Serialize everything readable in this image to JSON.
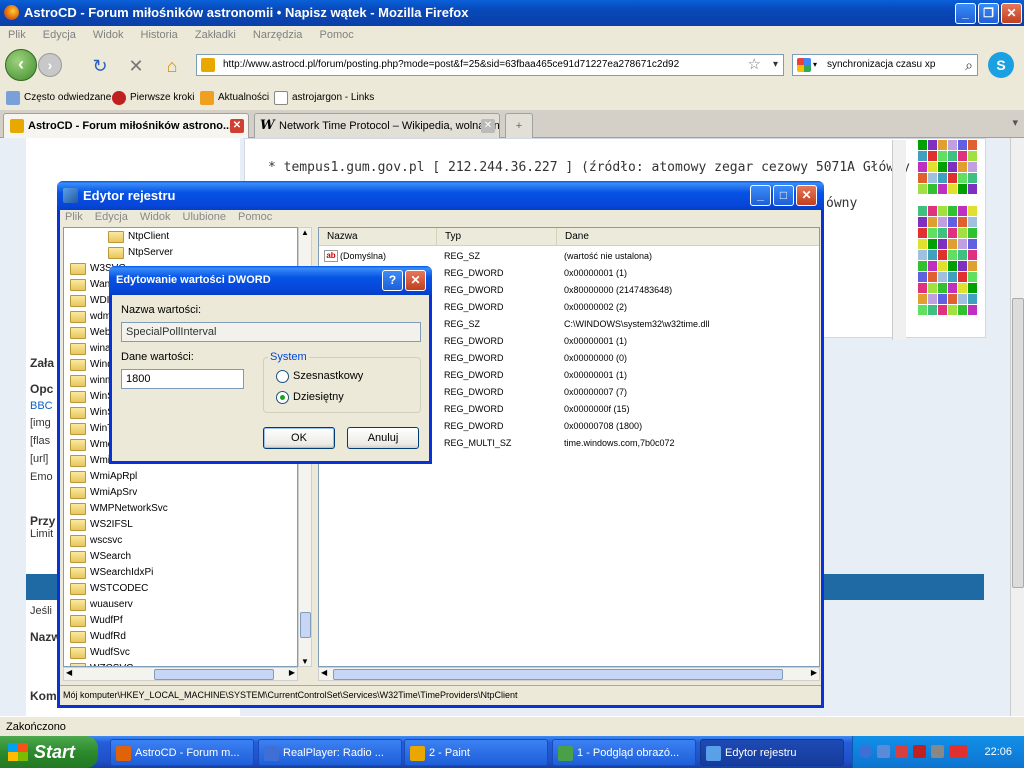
{
  "firefox": {
    "title": "AstroCD - Forum miłośników astronomii • Napisz wątek - Mozilla Firefox",
    "menu": [
      "Plik",
      "Edycja",
      "Widok",
      "Historia",
      "Zakładki",
      "Narzędzia",
      "Pomoc"
    ],
    "url": "http://www.astrocd.pl/forum/posting.php?mode=post&f=25&sid=63fbaa465ce91d71227ea278671c2d92",
    "search_value": "synchronizacja czasu xp",
    "bookmarks": [
      "Często odwiedzane",
      "Pierwsze kroki",
      "Aktualności",
      "astrojargon - Links"
    ],
    "tabs": [
      {
        "label": "AstroCD - Forum miłośników astrono...",
        "active": true
      },
      {
        "label": "Network Time Protocol – Wikipedia, wolna en...",
        "active": false
      }
    ],
    "new_tab_symbol": "+",
    "status": "Zakończono"
  },
  "page": {
    "line1": "* tempus1.gum.gov.pl [ 212.244.36.227 ] (źródło: atomowy zegar cezowy 5071A Główny",
    "line2_tail": "ówny",
    "side_labels": [
      "Zała",
      "Opc",
      "BBC",
      "[img",
      "[flas",
      "[url]",
      "Emo",
      "Przy",
      "Limit",
      "Jeśli",
      "Nazw",
      "Kom"
    ]
  },
  "regedit": {
    "title": "Edytor rejestru",
    "menu": [
      "Plik",
      "Edycja",
      "Widok",
      "Ulubione",
      "Pomoc"
    ],
    "tree": [
      "NtpClient",
      "NtpServer",
      "W3SVC",
      "WanArp",
      "WDICA",
      "wdmaud",
      "WebClient",
      "winachsf",
      "Windows",
      "winmgmt",
      "WinSock",
      "WinSock2",
      "WinTrust",
      "Wmdmpmsn",
      "Wmi",
      "WmiApRpl",
      "WmiApSrv",
      "WMPNetworkSvc",
      "WS2IFSL",
      "wscsvc",
      "WSearch",
      "WSearchIdxPi",
      "WSTCODEC",
      "wuauserv",
      "WudfPf",
      "WudfRd",
      "WudfSvc",
      "WZCSVC"
    ],
    "columns": [
      "Nazwa",
      "Typ",
      "Dane"
    ],
    "rows": [
      {
        "name": "(Domyślna)",
        "type": "REG_SZ",
        "data": "(wartość nie ustalona)"
      },
      {
        "name": "",
        "type": "REG_DWORD",
        "data": "0x00000001 (1)"
      },
      {
        "name": "",
        "type": "REG_DWORD",
        "data": "0x80000000 (2147483648)"
      },
      {
        "name": "",
        "type": "REG_DWORD",
        "data": "0x00000002 (2)"
      },
      {
        "name": "",
        "type": "REG_SZ",
        "data": "C:\\WINDOWS\\system32\\w32time.dll"
      },
      {
        "name": "",
        "type": "REG_DWORD",
        "data": "0x00000001 (1)"
      },
      {
        "name": "",
        "type": "REG_DWORD",
        "data": "0x00000000 (0)"
      },
      {
        "name": "",
        "type": "REG_DWORD",
        "data": "0x00000001 (1)"
      },
      {
        "name": "",
        "type": "REG_DWORD",
        "data": "0x00000007 (7)"
      },
      {
        "name": "",
        "type": "REG_DWORD",
        "data": "0x0000000f (15)"
      },
      {
        "name": "",
        "type": "REG_DWORD",
        "data": "0x00000708 (1800)"
      },
      {
        "name": "",
        "type": "REG_MULTI_SZ",
        "data": "time.windows.com,7b0c072"
      }
    ],
    "status": "Mój komputer\\HKEY_LOCAL_MACHINE\\SYSTEM\\CurrentControlSet\\Services\\W32Time\\TimeProviders\\NtpClient"
  },
  "dialog": {
    "title": "Edytowanie wartości DWORD",
    "name_label": "Nazwa wartości:",
    "name_value": "SpecialPollInterval",
    "data_label": "Dane wartości:",
    "data_value": "1800",
    "group_label": "System",
    "radio_hex": "Szesnastkowy",
    "radio_dec": "Dziesiętny",
    "selected_base": "dec",
    "ok": "OK",
    "cancel": "Anuluj",
    "help_symbol": "?"
  },
  "taskbar": {
    "start": "Start",
    "tasks": [
      {
        "label": "AstroCD - Forum m...",
        "active": false,
        "color": "#e0620a"
      },
      {
        "label": "RealPlayer: Radio ...",
        "active": false,
        "color": "#3d6fd6"
      },
      {
        "label": "2 - Paint",
        "active": false,
        "color": "#e8a800"
      },
      {
        "label": "1 - Podgląd obrazó...",
        "active": false,
        "color": "#4aa048"
      },
      {
        "label": "Edytor rejestru",
        "active": true,
        "color": "#5aa0e8"
      }
    ],
    "clock": "22:06"
  }
}
